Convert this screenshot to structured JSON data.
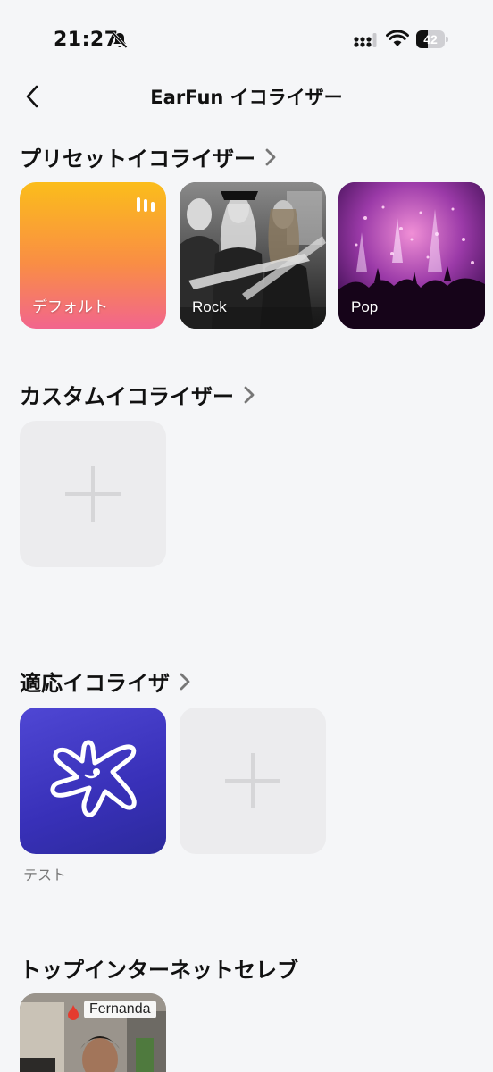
{
  "status_bar": {
    "time": "21:27",
    "battery_level": "42",
    "battery_fraction": 0.42
  },
  "header": {
    "title": "EarFun イコライザー"
  },
  "preset_section": {
    "title": "プリセットイコライザー",
    "items": [
      {
        "label": "デフォルト",
        "active": true
      },
      {
        "label": "Rock"
      },
      {
        "label": "Pop"
      }
    ]
  },
  "custom_section": {
    "title": "カスタムイコライザー"
  },
  "adaptive_section": {
    "title": "適応イコライザ",
    "items": [
      {
        "label": "テスト"
      }
    ]
  },
  "celebrity_section": {
    "title": "トップインターネットセレブ",
    "items": [
      {
        "name": "Fernanda"
      }
    ]
  },
  "colors": {
    "accent_gradient_top": "#fbbd1b",
    "accent_gradient_bottom": "#f2658d",
    "adaptive_tile": "#3b35c0",
    "background": "#f5f6f8"
  }
}
